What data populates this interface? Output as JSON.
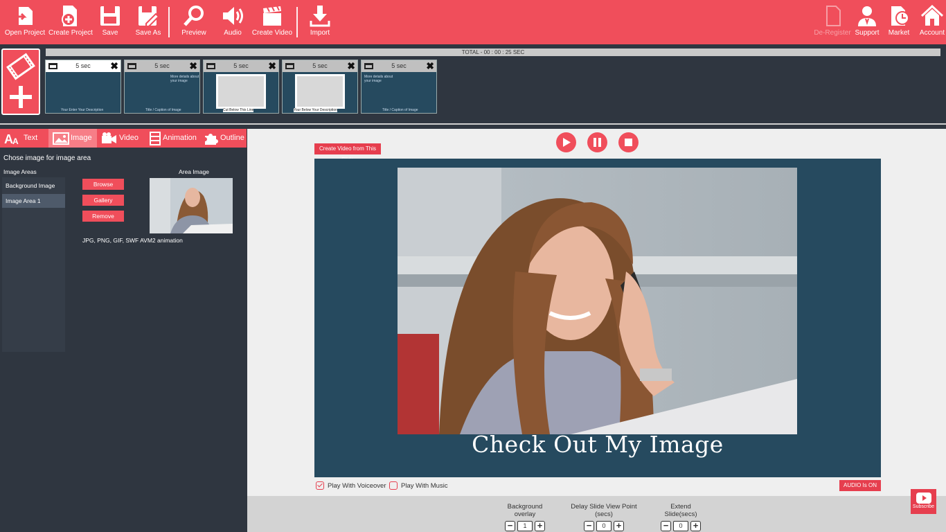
{
  "toolbar": {
    "open_project": "Open Project",
    "create_project": "Create Project",
    "save": "Save",
    "save_as": "Save As",
    "preview": "Preview",
    "audio": "Audio",
    "create_video": "Create Video",
    "import": "Import",
    "deregister": "De-Register",
    "support": "Support",
    "market": "Market",
    "account": "Account"
  },
  "timeline": {
    "total": "TOTAL - 00 : 00 : 25 SEC",
    "slides": [
      {
        "duration": "5 sec",
        "text_top": "",
        "text_bottom": "Your Enter Your Description"
      },
      {
        "duration": "5 sec",
        "text_top": "More details about your image",
        "text_bottom": "Title / Caption of Image"
      },
      {
        "duration": "5 sec",
        "text_top": "",
        "text_bottom": "Cut Below This Line"
      },
      {
        "duration": "5 sec",
        "text_top": "",
        "text_bottom": "Your Below Your Description"
      },
      {
        "duration": "5 sec",
        "text_top": "More details about your image",
        "text_bottom": "Title / Caption of Image"
      }
    ]
  },
  "tabs": [
    "Text",
    "Image",
    "Video",
    "Animation",
    "Outline"
  ],
  "image_panel": {
    "title": "Chose image for image area",
    "areas_label": "Image Areas",
    "areas": [
      "Background Image",
      "Image Area 1"
    ],
    "browse": "Browse",
    "gallery": "Gallery",
    "remove": "Remove",
    "area_image_label": "Area Image",
    "formats": "JPG, PNG, GIF, SWF AVM2 animation"
  },
  "editor": {
    "create_from_slide": "Create Video from This Slide",
    "caption": "Check Out My Image",
    "play_voiceover": "Play With Voiceover",
    "play_voiceover_checked": true,
    "play_music": "Play With Music",
    "play_music_checked": false,
    "audio_status": "AUDIO Is ON"
  },
  "settings": {
    "background_overlay": {
      "label": "Background overlay",
      "value": "1"
    },
    "delay": {
      "label": "Delay Slide View Point (secs)",
      "value": "0"
    },
    "extend": {
      "label": "Extend Slide(secs)",
      "value": "0"
    }
  },
  "youtube": {
    "label": "Subscribe"
  },
  "colors": {
    "accent": "#f04e5b",
    "panel": "#2f3640",
    "slide_bg": "#264a5f"
  }
}
